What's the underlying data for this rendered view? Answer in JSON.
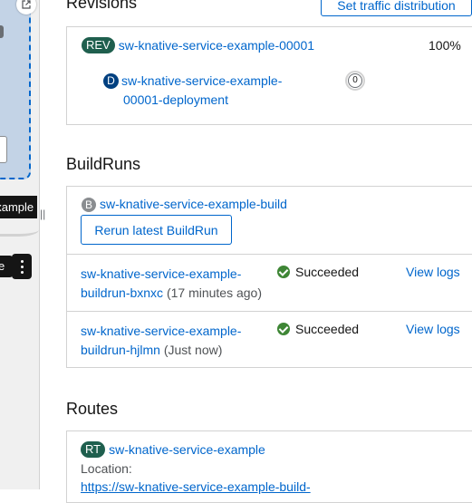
{
  "topology": {
    "node_label": "example",
    "action_label": "e"
  },
  "revisions": {
    "title": "Revisions",
    "traffic_button": "Set traffic distribution",
    "items": [
      {
        "badge": "REV",
        "name": "sw-knative-service-example-00001",
        "percent": "100%",
        "deployment": {
          "badge": "D",
          "name_line1": "sw-knative-service-example-",
          "name_line2": "00001-deployment",
          "pod_count": "0"
        }
      }
    ]
  },
  "buildruns": {
    "title": "BuildRuns",
    "build": {
      "badge": "B",
      "name": "sw-knative-service-example-build"
    },
    "rerun_button": "Rerun latest BuildRun",
    "runs": [
      {
        "name_line1": "sw-knative-service-example-",
        "name_line2": "buildrun-bxnxc",
        "time": "(17 minutes ago)",
        "status": "Succeeded",
        "logs": "View logs"
      },
      {
        "name_line1": "sw-knative-service-example-",
        "name_line2": "buildrun-hjlmn",
        "time": "(Just now)",
        "status": "Succeeded",
        "logs": "View logs"
      }
    ]
  },
  "routes": {
    "title": "Routes",
    "badge": "RT",
    "name": "sw-knative-service-example",
    "location_label": "Location:",
    "location_url": "https://sw-knative-service-example-build-"
  },
  "colors": {
    "link": "#0066cc",
    "success": "#3e8635",
    "rev_badge": "#1f5f4e",
    "deployment_badge": "#004080"
  }
}
